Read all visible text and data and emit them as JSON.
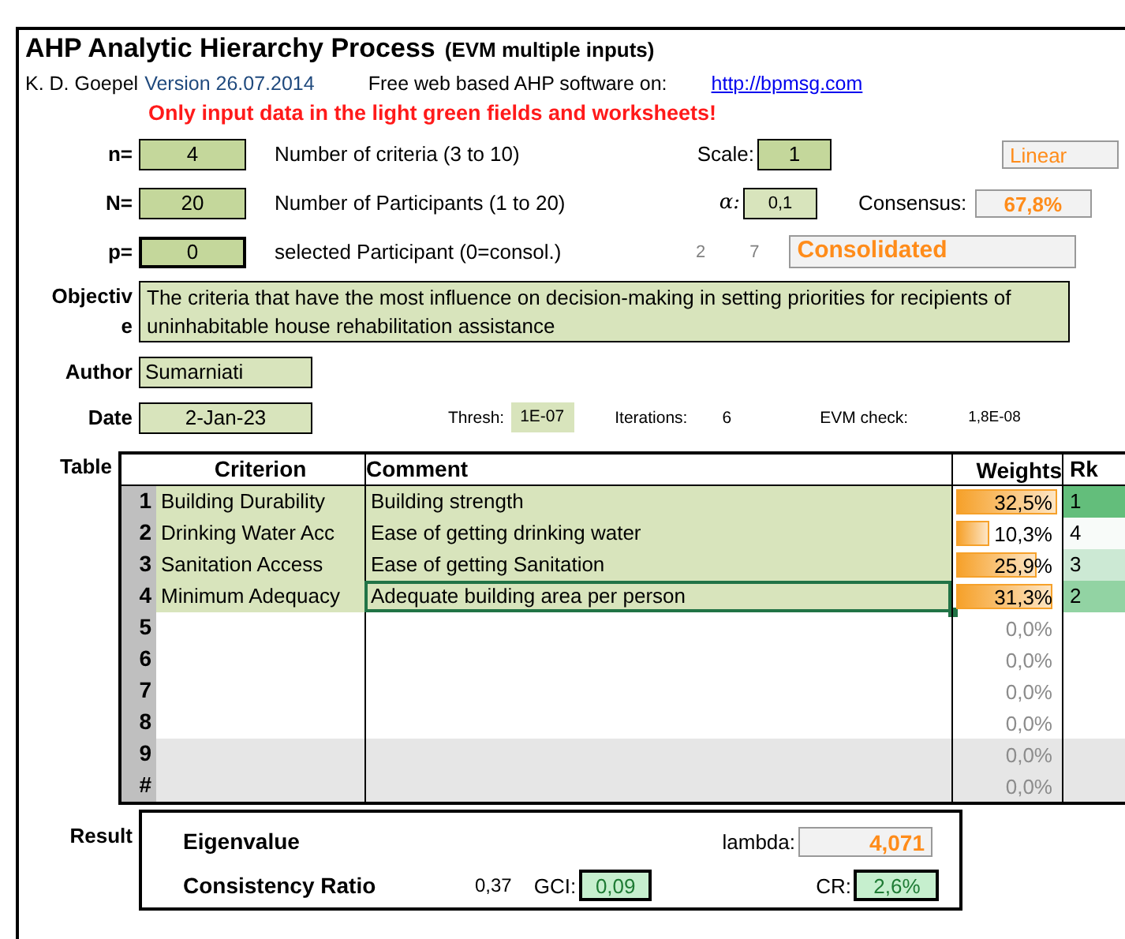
{
  "header": {
    "title": "AHP Analytic Hierarchy Process",
    "subtitle": "(EVM multiple inputs)",
    "author": "K. D. Goepel",
    "version": "Version 26.07.2014",
    "promo": "Free web based AHP software on:",
    "link": "http://bpmsg.com",
    "warning": "Only input data in the light green fields and worksheets!"
  },
  "criteria_count": {
    "label": "n=",
    "value": "4",
    "description": "Number of criteria (3 to 10)",
    "scale_label": "Scale:",
    "scale_value": "1",
    "scale_name": "Linear"
  },
  "participants": {
    "label": "N=",
    "value": "20",
    "description": "Number of Participants (1 to 20)",
    "alpha_label": "α:",
    "alpha_value": "0,1",
    "consensus_label": "Consensus:",
    "consensus_value": "67,8%"
  },
  "participant": {
    "label": "p=",
    "value": "0",
    "description": "selected Participant (0=consol.)",
    "number_1": "2",
    "number_2": "7",
    "status": "Consolidated"
  },
  "objective": {
    "label_1": "Objectiv",
    "label_2": "e",
    "value": "The criteria that have the most influence on decision-making in setting priorities for recipients of uninhabitable house rehabilitation assistance"
  },
  "author": {
    "label": "Author",
    "value": "Sumarniati"
  },
  "date": {
    "label": "Date",
    "value": "2-Jan-23",
    "thresh_label": "Thresh:",
    "thresh_value": "1E-07",
    "iterations_label": "Iterations:",
    "iterations_value": "6",
    "evm_label": "EVM check:",
    "evm_value": "1,8E-08"
  },
  "table": {
    "label": "Table",
    "columns": [
      "Criterion",
      "Comment",
      "Weights",
      "Rk"
    ],
    "rows": [
      {
        "number": "1",
        "criterion": "Building Durability",
        "comment": "Building strength",
        "weight": "32,5%",
        "level": 0.93,
        "rank": "1",
        "color": "#63be7b",
        "selected": false,
        "shaded": false
      },
      {
        "number": "2",
        "criterion": "Drinking Water Acc",
        "comment": "Ease of getting drinking water",
        "weight": "10,3%",
        "level": 0.3,
        "rank": "4",
        "color": "#f8fbf9",
        "selected": false,
        "shaded": false
      },
      {
        "number": "3",
        "criterion": "Sanitation Access",
        "comment": "Ease of getting Sanitation",
        "weight": "25,9%",
        "level": 0.74,
        "rank": "3",
        "color": "#cce9d4",
        "selected": false,
        "shaded": false
      },
      {
        "number": "4",
        "criterion": "Minimum Adequacy",
        "comment": "Adequate building area per person",
        "weight": "31,3%",
        "level": 0.89,
        "rank": "2",
        "color": "#92d3a3",
        "selected": true,
        "shaded": false
      },
      {
        "number": "5",
        "weight": "0,0%",
        "selected": false,
        "shaded": false
      },
      {
        "number": "6",
        "weight": "0,0%",
        "selected": false,
        "shaded": false
      },
      {
        "number": "7",
        "weight": "0,0%",
        "selected": false,
        "shaded": false
      },
      {
        "number": "8",
        "weight": "0,0%",
        "selected": false,
        "shaded": false
      },
      {
        "number": "9",
        "weight": "0,0%",
        "selected": false,
        "shaded": true
      },
      {
        "number": "#",
        "weight": "0,0%",
        "selected": false,
        "shaded": true
      }
    ]
  },
  "result": {
    "label": "Result",
    "eigen_label": "Eigenvalue",
    "lambda_label": "lambda:",
    "lambda_value": "4,071",
    "cr_label": "Consistency Ratio",
    "ci_value": "0,37",
    "gci_label": "GCI:",
    "gci_value": "0,09",
    "cr_short": "CR:",
    "cr_value": "2,6%"
  }
}
